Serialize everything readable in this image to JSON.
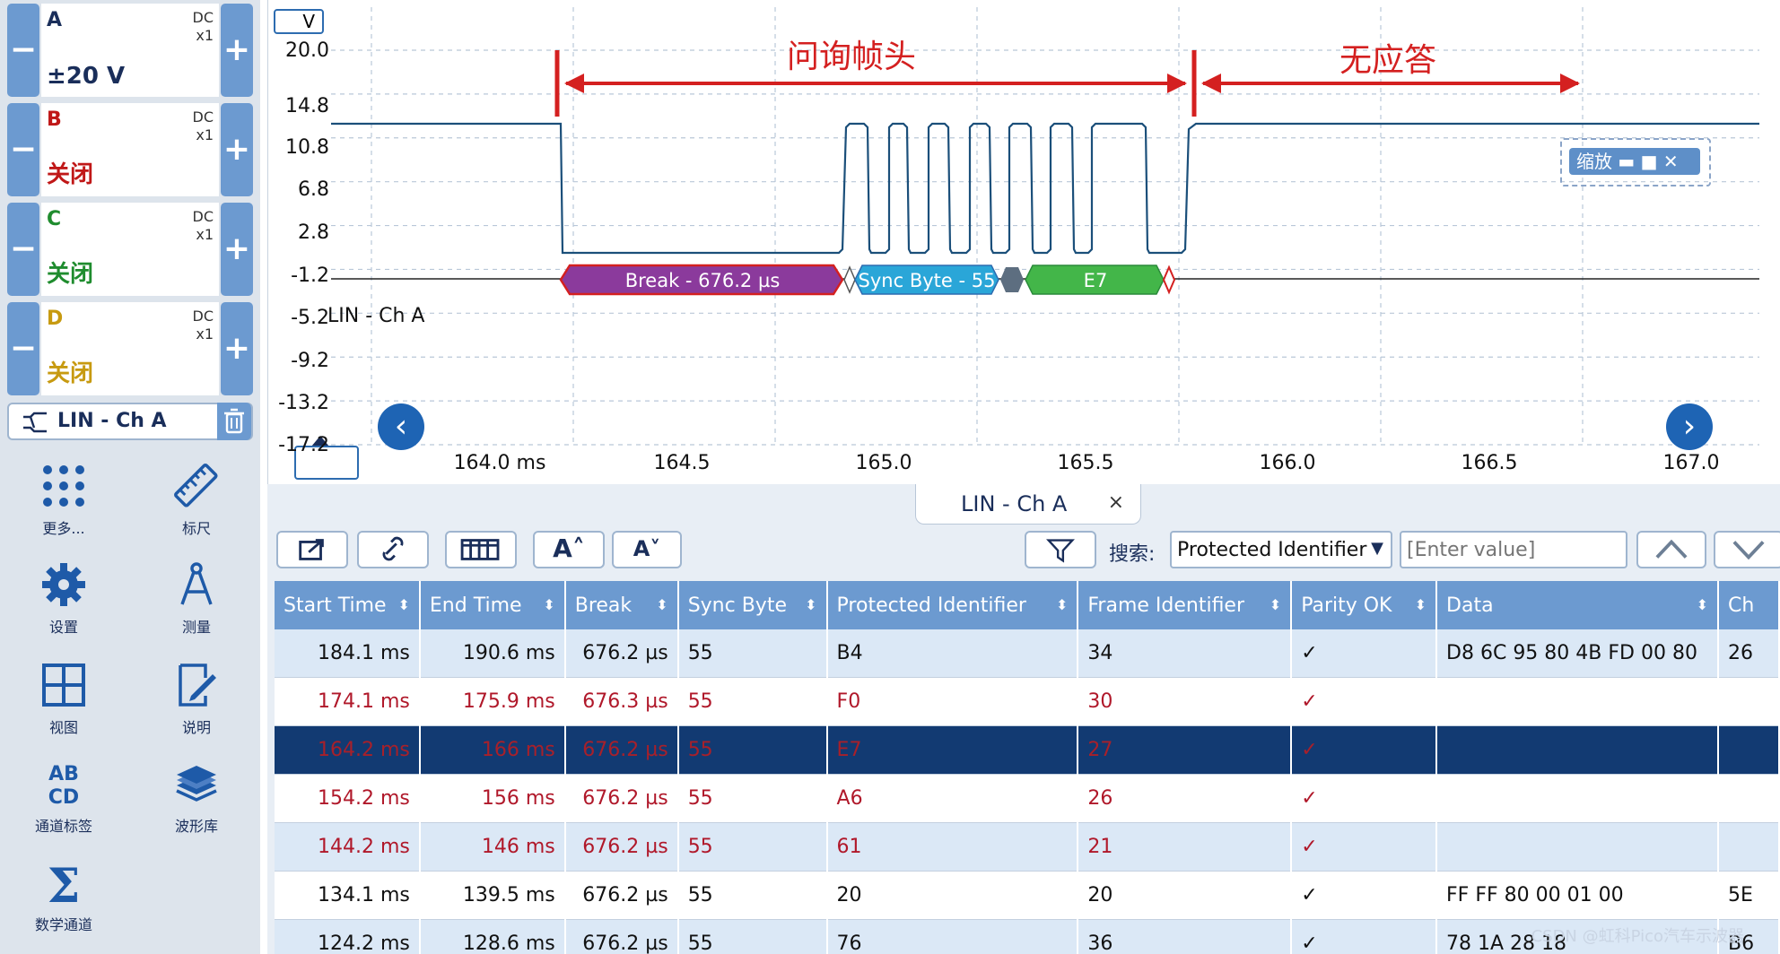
{
  "channels": [
    {
      "letter": "A",
      "coupling": "DC",
      "probe": "x1",
      "range": "±20 V",
      "color": "#1a2e5a",
      "range_color": "#1a2e5a"
    },
    {
      "letter": "B",
      "coupling": "DC",
      "probe": "x1",
      "range": "关闭",
      "color": "#c01818",
      "range_color": "#c01818"
    },
    {
      "letter": "C",
      "coupling": "DC",
      "probe": "x1",
      "range": "关闭",
      "color": "#1f8c2e",
      "range_color": "#1f8c2e"
    },
    {
      "letter": "D",
      "coupling": "DC",
      "probe": "x1",
      "range": "关闭",
      "color": "#c79a10",
      "range_color": "#c79a10"
    }
  ],
  "channel_buttons": {
    "minus": "−",
    "plus": "+"
  },
  "lin_chip": {
    "label": "LIN - Ch A"
  },
  "tools": [
    {
      "label": "更多...",
      "icon": "grid-dots-icon"
    },
    {
      "label": "标尺",
      "icon": "ruler-icon"
    },
    {
      "label": "设置",
      "icon": "gear-icon"
    },
    {
      "label": "测量",
      "icon": "compass-icon"
    },
    {
      "label": "视图",
      "icon": "view-grid-icon"
    },
    {
      "label": "说明",
      "icon": "note-edit-icon"
    },
    {
      "label": "通道标签",
      "icon": "abcd-icon"
    },
    {
      "label": "波形库",
      "icon": "waveform-library-icon"
    },
    {
      "label": "数学通道",
      "icon": "sigma-icon"
    }
  ],
  "scope": {
    "unit_badge": "V",
    "y_ticks": [
      "20.0",
      "14.8",
      "10.8",
      "6.8",
      "2.8",
      "-1.2",
      "-5.2",
      "-9.2",
      "-13.2",
      "-17.2"
    ],
    "x_ticks": [
      "164.0 ms",
      "164.5",
      "165.0",
      "165.5",
      "166.0",
      "166.5",
      "167.0"
    ],
    "channel_label": "LIN - Ch A",
    "annotation_header": "问询帧头",
    "annotation_noresp": "无应答",
    "zoom_label": "缩放",
    "decode_segments": {
      "break": "Break - 676.2 µs",
      "sync": "Sync Byte - 55",
      "id": "E7"
    }
  },
  "decode_panel": {
    "tab_label": "LIN - Ch A",
    "tab_close": "×",
    "search_label": "搜索:",
    "search_field": "Protected Identifier",
    "search_placeholder": "[Enter value]",
    "columns": [
      "Start Time",
      "End Time",
      "Break",
      "Sync Byte",
      "Protected Identifier",
      "Frame Identifier",
      "Parity OK",
      "Data",
      "Ch"
    ],
    "rows": [
      {
        "style": "odd black",
        "cells": [
          "184.1 ms",
          "190.6 ms",
          "676.2 µs",
          "55",
          "B4",
          "34",
          "✓",
          "D8 6C 95 80 4B FD 00 80",
          "26"
        ]
      },
      {
        "style": "even red",
        "cells": [
          "174.1 ms",
          "175.9 ms",
          "676.3 µs",
          "55",
          "F0",
          "30",
          "✓",
          "",
          ""
        ]
      },
      {
        "style": "sel",
        "cells": [
          "164.2 ms",
          "166 ms",
          "676.2 µs",
          "55",
          "E7",
          "27",
          "✓",
          "",
          ""
        ]
      },
      {
        "style": "even red",
        "cells": [
          "154.2 ms",
          "156 ms",
          "676.2 µs",
          "55",
          "A6",
          "26",
          "✓",
          "",
          ""
        ]
      },
      {
        "style": "odd red",
        "cells": [
          "144.2 ms",
          "146 ms",
          "676.2 µs",
          "55",
          "61",
          "21",
          "✓",
          "",
          ""
        ]
      },
      {
        "style": "even black",
        "cells": [
          "134.1 ms",
          "139.5 ms",
          "676.2 µs",
          "55",
          "20",
          "20",
          "✓",
          "FF FF 80 00 01 00",
          "5E"
        ]
      },
      {
        "style": "odd black",
        "cells": [
          "124.2 ms",
          "128.6 ms",
          "676.2 µs",
          "55",
          "76",
          "36",
          "✓",
          "78 1A 28 18",
          "B6"
        ]
      }
    ]
  },
  "watermark": "CSDN @虹科Pico汽车示波器",
  "colors": {
    "accent": "#6c9ad0",
    "trace": "#1b4f7a",
    "annotation": "#d42020",
    "break_seg": "#8b3a9c",
    "sync_seg": "#2aa6d8",
    "id_seg": "#43b649",
    "selected_row": "#123a72"
  }
}
